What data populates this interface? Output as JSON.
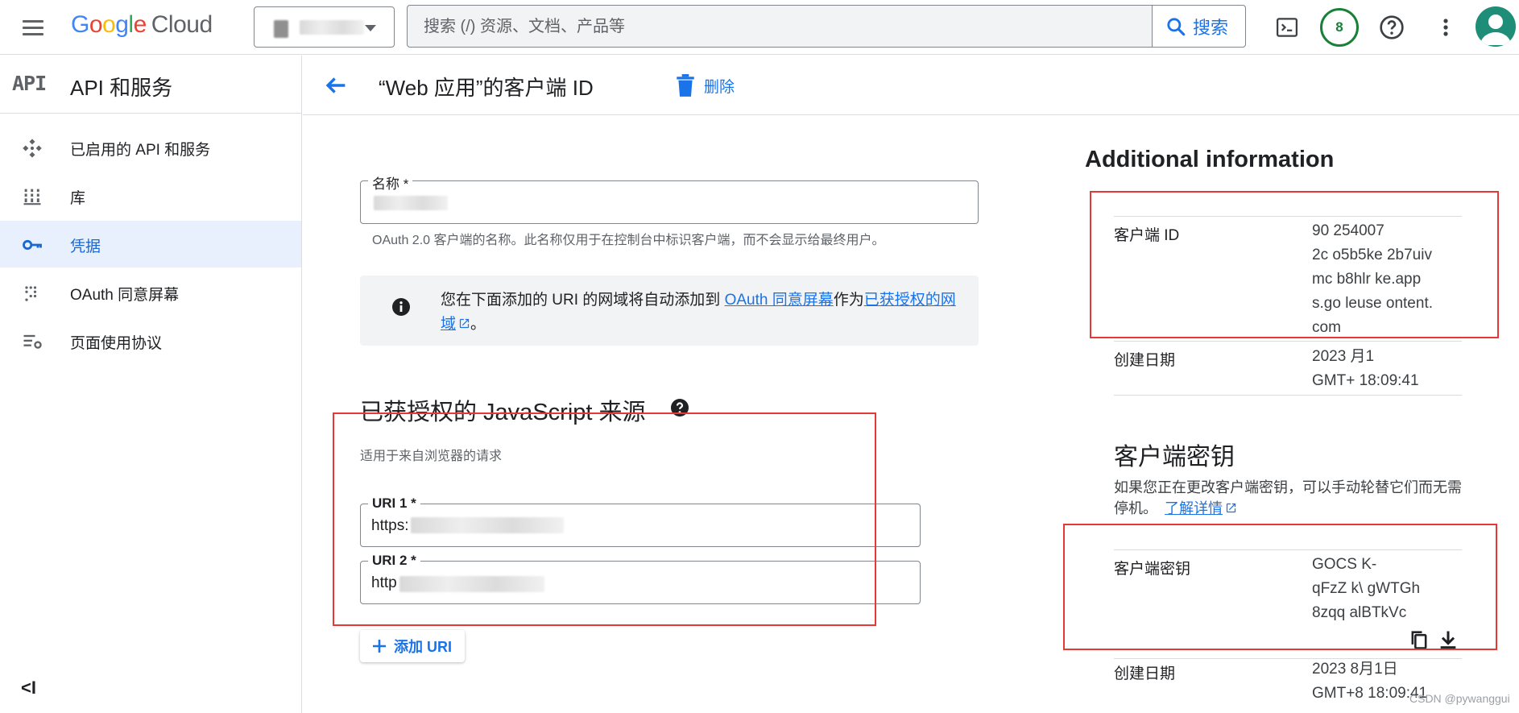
{
  "header": {
    "logo_parts": [
      "G",
      "o",
      "o",
      "g",
      "l",
      "e"
    ],
    "logo_product": "Cloud",
    "search_placeholder": "搜索 (/) 资源、文档、产品等",
    "search_button": "搜索",
    "notification_count": "8"
  },
  "sidebar": {
    "api_logo": "API",
    "title": "API 和服务",
    "items": [
      {
        "label": "已启用的 API 和服务",
        "icon": "enabled-apis-icon"
      },
      {
        "label": "库",
        "icon": "library-icon"
      },
      {
        "label": "凭据",
        "icon": "key-icon",
        "active": true
      },
      {
        "label": "OAuth 同意屏幕",
        "icon": "consent-screen-icon"
      },
      {
        "label": "页面使用协议",
        "icon": "page-settings-icon"
      }
    ],
    "collapse_label": "<I"
  },
  "page": {
    "title": "“Web 应用”的客户端 ID",
    "delete_label": "删除"
  },
  "form": {
    "name_label": "名称 *",
    "name_hint": "OAuth 2.0 客户端的名称。此名称仅用于在控制台中标识客户端，而不会显示给最终用户。",
    "info_text_1": "您在下面添加的 URI 的网域将自动添加到 ",
    "info_link_1": "OAuth 同意屏幕",
    "info_text_2": "作为",
    "info_link_2": "已获授权的网域",
    "info_text_3": "。",
    "js_origins_title": "已获授权的 JavaScript 来源",
    "js_origins_hint": "适用于来自浏览器的请求",
    "uris": [
      {
        "label": "URI 1 *",
        "value": "https:"
      },
      {
        "label": "URI 2 *",
        "value": "http"
      }
    ],
    "add_uri_label": "添加 URI"
  },
  "additional_info": {
    "title": "Additional information",
    "client_id_label": "客户端 ID",
    "client_id_lines": [
      "90   254007",
      "2c   o5b5ke   2b7uiv",
      "mc   b8hlr   ke.app",
      "s.go   leuse   ontent.",
      "com"
    ],
    "created_label": "创建日期",
    "created_lines": [
      "2023   月1",
      "GMT+   18:09:41"
    ],
    "secret_title": "客户端密钥",
    "secret_desc": "如果您正在更改客户端密钥，可以手动轮替它们而无需停机。",
    "secret_learn_more": "了解详情",
    "secret_label": "客户端密钥",
    "secret_lines": [
      "GOCS   K-",
      "qFzZ   k\\   gWTGh",
      "8zqq   alBTkVc"
    ],
    "secret_created_label": "创建日期",
    "secret_created_lines": [
      "2023   8月1日",
      "GMT+8 18:09:41"
    ]
  },
  "watermark": "CSDN @pywanggui"
}
